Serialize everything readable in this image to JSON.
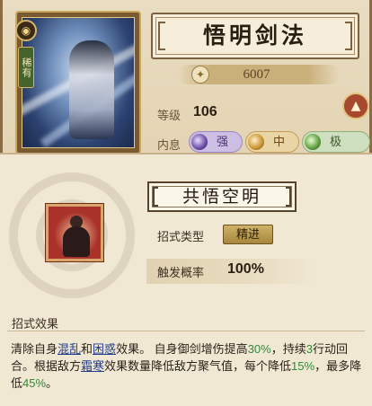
{
  "character": {
    "badge_glyph": "◉",
    "rank_label": "稀有"
  },
  "skill": {
    "name": "悟明剑法",
    "power_value": "6007",
    "level_label": "等级",
    "level_value": "106",
    "neigong_label": "内息",
    "neigong_options": [
      {
        "label": "强",
        "color": "#6b4aa3"
      },
      {
        "label": "中",
        "color": "#c7902d"
      },
      {
        "label": "极",
        "color": "#5b9b3c"
      }
    ]
  },
  "detail": {
    "title": "共悟空明",
    "type_label": "招式类型",
    "type_value": "精进",
    "rate_label": "触发概率",
    "rate_value": "100%",
    "effect_heading": "招式效果",
    "effect": {
      "p1": "清除自身",
      "kw1": "混乱",
      "p2": "和",
      "kw2": "困惑",
      "p3": "效果。 自身御剑增伤提高",
      "n1": "30%",
      "p4": "，持续",
      "n2": "3",
      "p5": "行动回合。根据敌方",
      "kw3": "霜寒",
      "p6": "效果数量降低敌方聚气值，每个降低",
      "n3": "15%",
      "p7": "，最多降低",
      "n4": "45%",
      "p8": "。"
    }
  },
  "colors": {
    "keyword": "#1f3a8a",
    "number": "#2f8a3a",
    "panel_bg": "#f1e8d4"
  }
}
